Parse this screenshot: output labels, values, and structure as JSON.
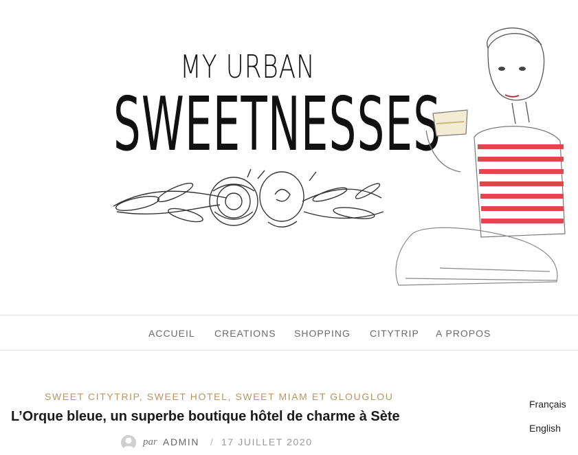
{
  "header": {
    "logo_line1": "MY URBAN",
    "logo_line2": "SWEETNESSES"
  },
  "nav": {
    "items": [
      "ACCUEIL",
      "CREATIONS",
      "SHOPPING",
      "CITYTRIP",
      "A PROPOS"
    ]
  },
  "post": {
    "categories": [
      "SWEET CITYTRIP",
      "SWEET HOTEL",
      "SWEET MIAM ET GLOUGLOU"
    ],
    "title": "L’Orque bleue, un superbe boutique hôtel de charme à Sète",
    "by_label": "par",
    "author": "ADMIN",
    "separator": "/",
    "date": "17 JUILLET 2020"
  },
  "languages": [
    "Français",
    "English"
  ],
  "colors": {
    "category": "#b89560",
    "nav_text": "#6b6b6b",
    "stripes": "#e0474c"
  }
}
